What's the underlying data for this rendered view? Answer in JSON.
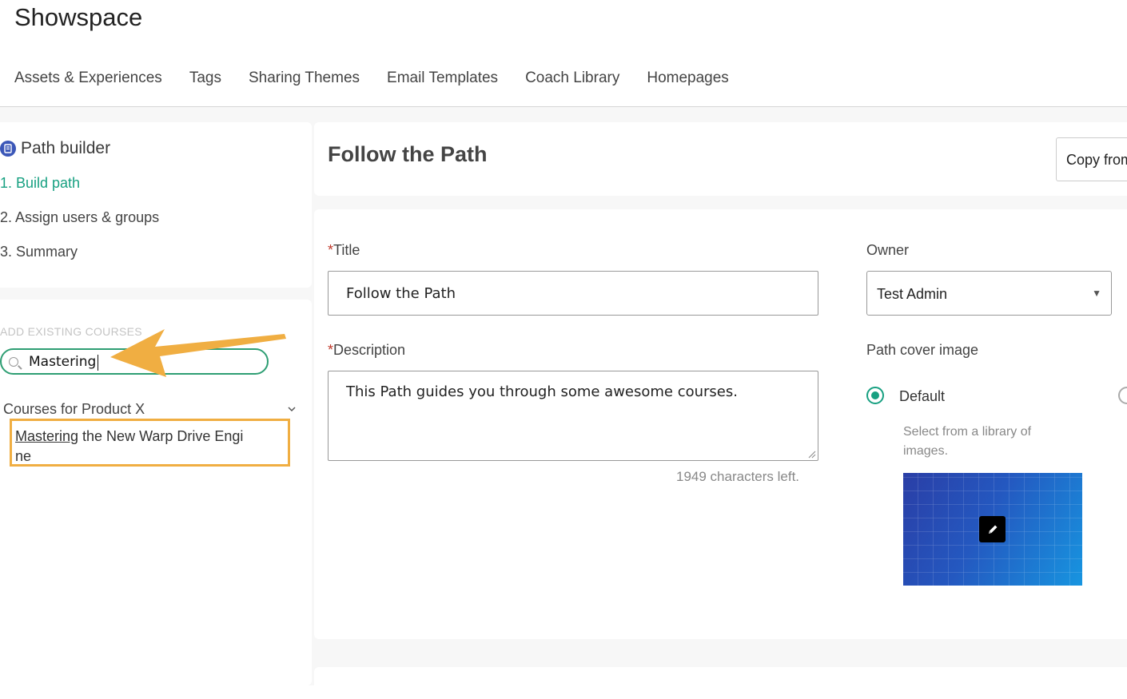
{
  "app": {
    "title": "Showspace"
  },
  "topnav": {
    "items": [
      "Assets & Experiences",
      "Tags",
      "Sharing Themes",
      "Email Templates",
      "Coach Library",
      "Homepages"
    ]
  },
  "path_builder": {
    "title": "Path builder",
    "steps": [
      "1. Build path",
      "2. Assign users & groups",
      "3. Summary"
    ],
    "active_step": 0
  },
  "courses": {
    "section_label": "ADD EXISTING COURSES",
    "search_value": "Mastering",
    "group_label": "Courses for Product X",
    "result_highlight": "Mastering",
    "result_rest_line1": " the New Warp Drive Engi",
    "result_line2": "ne"
  },
  "header": {
    "title": "Follow the Path",
    "copy_button": "Copy from"
  },
  "form": {
    "title_label": "Title",
    "title_value": "Follow the Path",
    "description_label": "Description",
    "description_value": "This Path guides you through some awesome courses.",
    "chars_left": "1949 characters left.",
    "required_mark": "*",
    "owner_label": "Owner",
    "owner_value": "Test Admin",
    "cover_label": "Path cover image",
    "cover_option_default": "Default",
    "cover_option_help": "Select from a library of images."
  },
  "colors": {
    "accent": "#17a081",
    "highlight_border": "#f0ae42",
    "arrow": "#f0ae42",
    "search_border": "#2e9e73"
  }
}
